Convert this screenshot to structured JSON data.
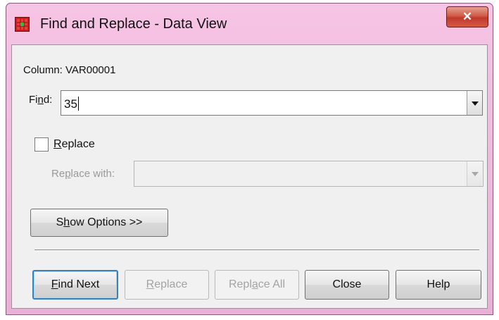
{
  "window": {
    "title": "Find and Replace - Data View",
    "close_glyph": "✕",
    "colors": {
      "title_bar": "#eab0d6",
      "close_button": "#c0392b",
      "dialog_background": "#f0f0f0"
    }
  },
  "column": {
    "label": "Column: VAR00001"
  },
  "find": {
    "label_prefix": "Fi",
    "label_mnemonic": "n",
    "label_suffix": "d:",
    "value": "35"
  },
  "replace_toggle": {
    "checked": false,
    "label_mnemonic": "R",
    "label_rest": "eplace"
  },
  "replace_with": {
    "label_prefix": "Re",
    "label_mnemonic": "p",
    "label_suffix": "lace with:",
    "value": ""
  },
  "buttons": {
    "show_options": {
      "prefix": "S",
      "mnemonic": "h",
      "suffix": "ow Options >>"
    },
    "find_next": {
      "mnemonic": "F",
      "suffix": "ind Next"
    },
    "replace": {
      "mnemonic": "R",
      "suffix": "eplace"
    },
    "replace_all": {
      "prefix": "Repl",
      "mnemonic": "a",
      "suffix": "ce All"
    },
    "close": "Close",
    "help": "Help"
  },
  "icons": [
    "app-grid-icon",
    "close-icon",
    "dropdown-arrow-icon"
  ]
}
